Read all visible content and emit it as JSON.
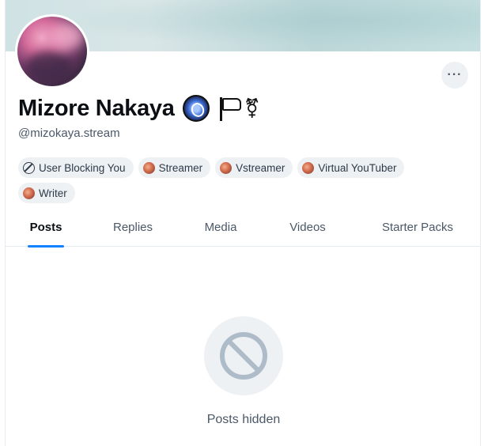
{
  "profile": {
    "display_name": "Mizore Nakaya",
    "handle": "@mizokaya.stream",
    "more_button_label": "···"
  },
  "labels": [
    {
      "text": "User Blocking You",
      "icon": "block-icon"
    },
    {
      "text": "Streamer",
      "icon": "labeler-avatar-icon"
    },
    {
      "text": "Vstreamer",
      "icon": "labeler-avatar-icon"
    },
    {
      "text": "Virtual YouTuber",
      "icon": "labeler-avatar-icon"
    },
    {
      "text": "Writer",
      "icon": "labeler-avatar-icon"
    }
  ],
  "tabs": [
    {
      "label": "Posts",
      "active": true
    },
    {
      "label": "Replies",
      "active": false
    },
    {
      "label": "Media",
      "active": false
    },
    {
      "label": "Videos",
      "active": false
    },
    {
      "label": "Starter Packs",
      "active": false
    }
  ],
  "empty_state": {
    "icon": "block-icon",
    "message": "Posts hidden"
  },
  "name_emojis": [
    "crystal-ball-icon",
    "white-flag-icon",
    "transgender-symbol-icon"
  ],
  "transgender_symbol": "⚧",
  "colors": {
    "accent": "#1083fe",
    "muted_text": "#4a5868",
    "chip_bg": "#eef1f4"
  }
}
